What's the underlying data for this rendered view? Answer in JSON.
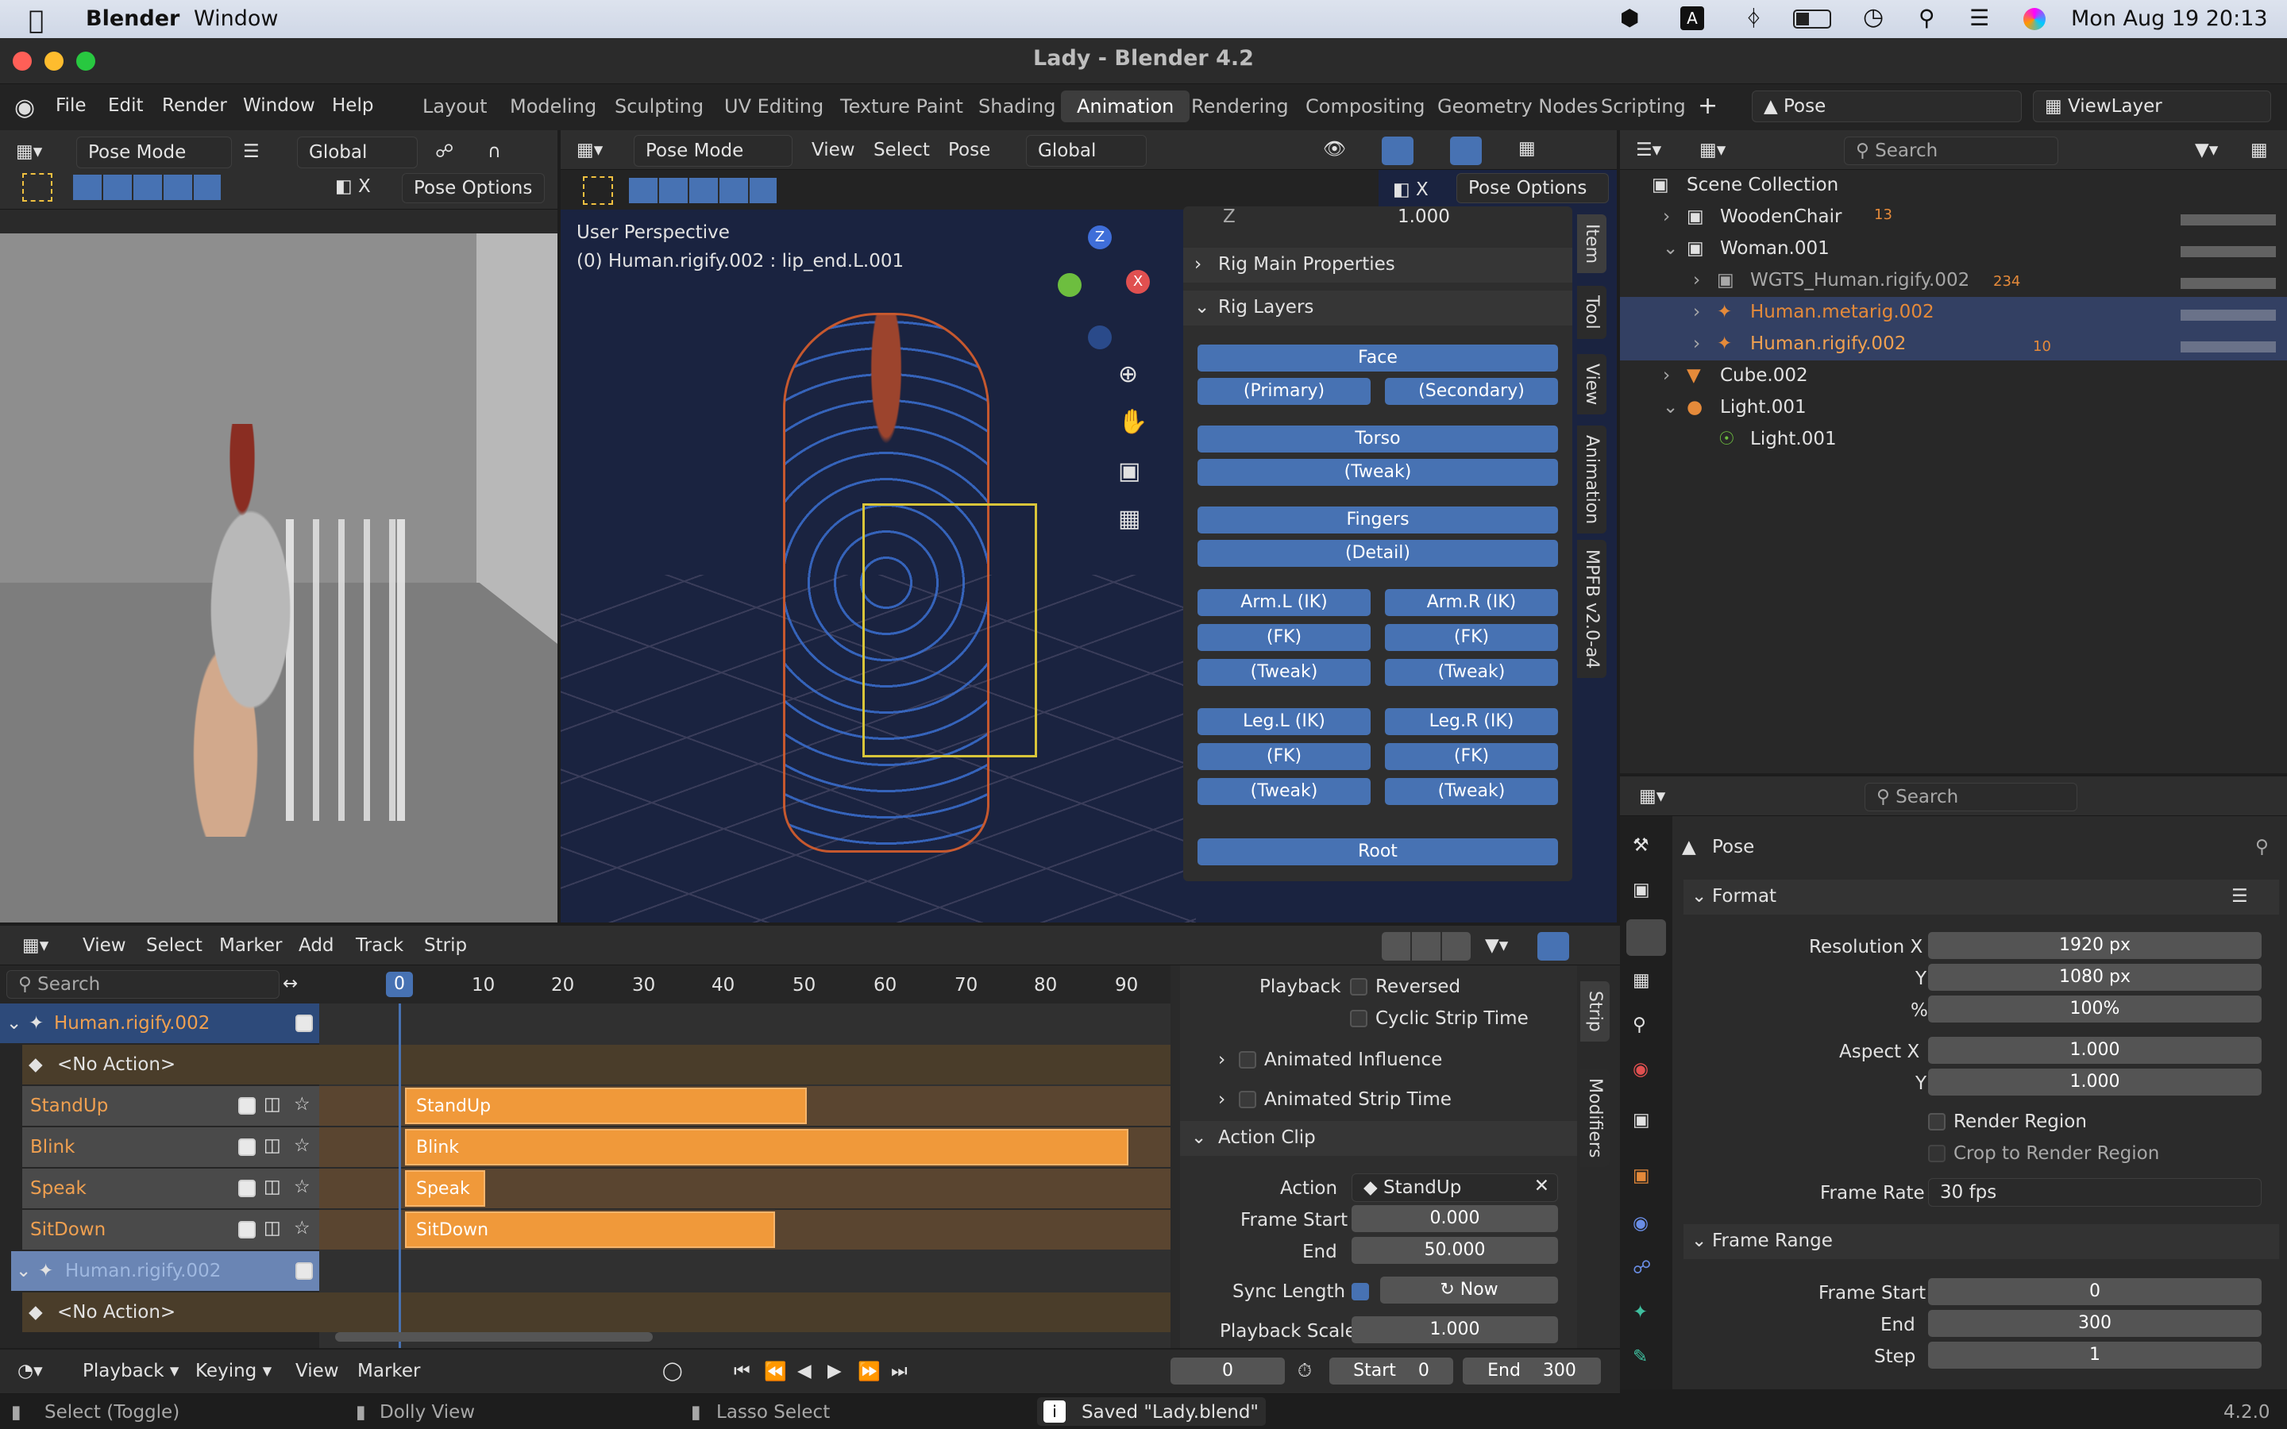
{
  "macos": {
    "app": "Blender",
    "menu": "Window",
    "clock": "Mon Aug 19  20:13",
    "input": "A"
  },
  "window": {
    "title": "Lady - Blender 4.2"
  },
  "menus": [
    "File",
    "Edit",
    "Render",
    "Window",
    "Help"
  ],
  "workspaces": [
    "Layout",
    "Modeling",
    "Sculpting",
    "UV Editing",
    "Texture Paint",
    "Shading",
    "Animation",
    "Rendering",
    "Compositing",
    "Geometry Nodes",
    "Scripting"
  ],
  "active_workspace": "Animation",
  "scene": {
    "pose": "Pose",
    "viewlayer": "ViewLayer"
  },
  "left_view": {
    "mode": "Pose Mode",
    "orient": "Global",
    "pose_options": "Pose Options"
  },
  "main_view": {
    "mode": "Pose Mode",
    "menus": [
      "View",
      "Select",
      "Pose"
    ],
    "orient": "Global",
    "pose_options": "Pose Options",
    "perspective": "User Perspective",
    "object_info": "(0) Human.rigify.002 : lip_end.L.001",
    "gizmo": {
      "z": "Z",
      "x": "X"
    }
  },
  "sidebar": {
    "z_label": "Z",
    "z_value": "1.000",
    "rig_main": "Rig Main Properties",
    "rig_layers": "Rig Layers",
    "face": "Face",
    "primary": "(Primary)",
    "secondary": "(Secondary)",
    "torso": "Torso",
    "tweak": "(Tweak)",
    "fingers": "Fingers",
    "detail": "(Detail)",
    "arm_l": "Arm.L (IK)",
    "arm_r": "Arm.R (IK)",
    "fk": "(FK)",
    "leg_l": "Leg.L (IK)",
    "leg_r": "Leg.R (IK)",
    "root": "Root",
    "tabs": [
      "Item",
      "Tool",
      "View",
      "Animation",
      "MPFB v2.0-a4"
    ]
  },
  "outliner": {
    "search": "Search",
    "title": "Scene Collection",
    "items": [
      {
        "name": "WoodenChair",
        "extra": "13"
      },
      {
        "name": "Woman.001"
      },
      {
        "name": "WGTS_Human.rigify.002",
        "extra": "234"
      },
      {
        "name": "Human.metarig.002"
      },
      {
        "name": "Human.rigify.002",
        "extra": "10"
      },
      {
        "name": "Cube.002"
      },
      {
        "name": "Light.001"
      },
      {
        "name": "Light.001"
      }
    ]
  },
  "properties": {
    "search": "Search",
    "context": "Pose",
    "format": "Format",
    "res_x_label": "Resolution X",
    "res_x": "1920 px",
    "y_label": "Y",
    "res_y": "1080 px",
    "pct_label": "%",
    "pct": "100%",
    "aspect_x_label": "Aspect X",
    "aspect_x": "1.000",
    "aspect_y": "1.000",
    "render_region": "Render Region",
    "crop": "Crop to Render Region",
    "frame_rate_label": "Frame Rate",
    "frame_rate": "30 fps",
    "frame_range": "Frame Range",
    "frame_start_label": "Frame Start",
    "frame_start": "0",
    "end_label": "End",
    "end": "300",
    "step_label": "Step",
    "step": "1"
  },
  "nla": {
    "menus": [
      "View",
      "Select",
      "Marker",
      "Add",
      "Track",
      "Strip"
    ],
    "search": "Search",
    "ticks": [
      "0",
      "10",
      "20",
      "30",
      "40",
      "50",
      "60",
      "70",
      "80",
      "90"
    ],
    "tracks": [
      {
        "name": "Human.rigify.002"
      },
      {
        "name": "<No Action>"
      },
      {
        "name": "StandUp"
      },
      {
        "name": "Blink"
      },
      {
        "name": "Speak"
      },
      {
        "name": "SitDown"
      },
      {
        "name": "Human.rigify.002"
      },
      {
        "name": "<No Action>"
      }
    ],
    "strips": [
      {
        "name": "StandUp",
        "start": 0,
        "end": 50
      },
      {
        "name": "Blink",
        "start": 0,
        "end": 90
      },
      {
        "name": "Speak",
        "start": 0,
        "end": 10
      },
      {
        "name": "SitDown",
        "start": 0,
        "end": 46
      }
    ]
  },
  "strip_panel": {
    "playback": "Playback",
    "reversed": "Reversed",
    "cyclic": "Cyclic Strip Time",
    "anim_influence": "Animated Influence",
    "anim_strip_time": "Animated Strip Time",
    "action_clip": "Action Clip",
    "action_label": "Action",
    "action": "StandUp",
    "frame_start_label": "Frame Start",
    "frame_start": "0.000",
    "end_label": "End",
    "end": "50.000",
    "sync_label": "Sync Length",
    "now": "Now",
    "playback_scale": "Playback Scale",
    "playback_scale_val": "1.000",
    "tabs": [
      "Strip",
      "Modifiers"
    ]
  },
  "timeline": {
    "playback": "Playback",
    "keying": "Keying",
    "view": "View",
    "marker": "Marker",
    "current": "0",
    "start_label": "Start",
    "start": "0",
    "end_label": "End",
    "end": "300"
  },
  "status": {
    "select": "Select (Toggle)",
    "dolly": "Dolly View",
    "lasso": "Lasso Select",
    "saved": "Saved \"Lady.blend\"",
    "version": "4.2.0"
  }
}
